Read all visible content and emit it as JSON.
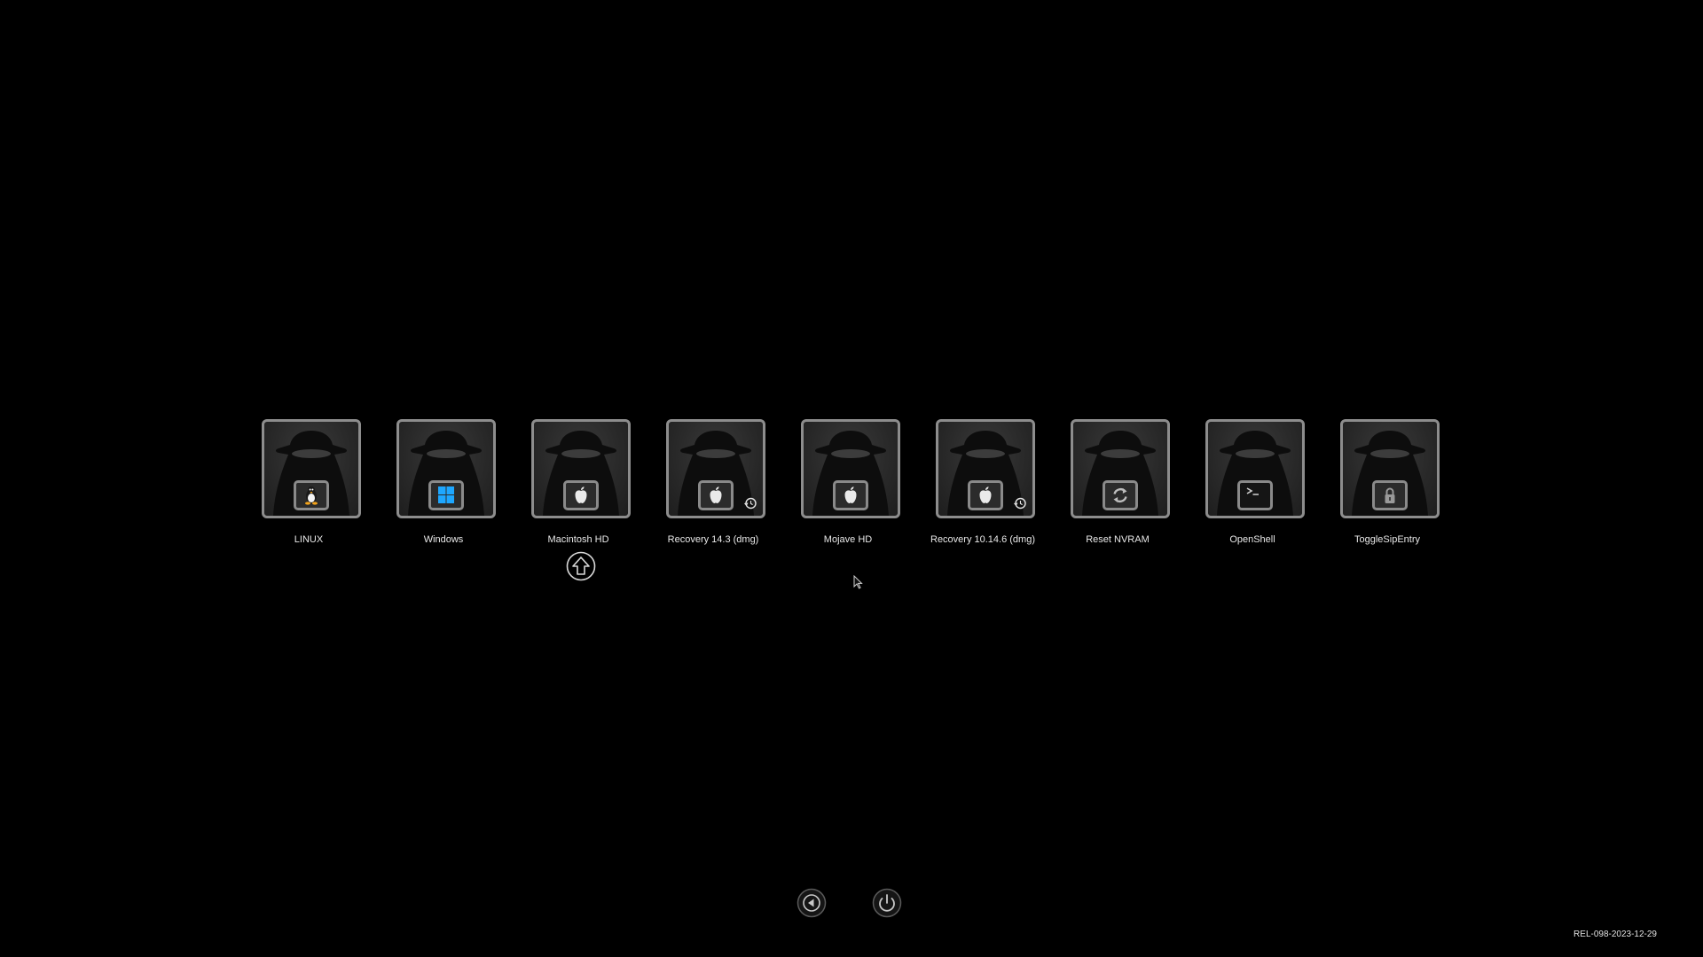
{
  "entries": [
    {
      "label": "LINUX",
      "badge_icon": "linux-penguin-icon",
      "recovery": false
    },
    {
      "label": "Windows",
      "badge_icon": "windows-logo-icon",
      "recovery": false
    },
    {
      "label": "Macintosh HD",
      "badge_icon": "apple-logo-icon",
      "recovery": false,
      "selected": true
    },
    {
      "label": "Recovery 14.3 (dmg)",
      "badge_icon": "apple-logo-icon",
      "recovery": true
    },
    {
      "label": "Mojave HD",
      "badge_icon": "apple-logo-icon",
      "recovery": false
    },
    {
      "label": "Recovery 10.14.6 (dmg)",
      "badge_icon": "apple-logo-icon",
      "recovery": true
    },
    {
      "label": "Reset NVRAM",
      "badge_icon": "reset-arrows-icon",
      "recovery": false
    },
    {
      "label": "OpenShell",
      "badge_icon": "terminal-prompt-icon",
      "recovery": false
    },
    {
      "label": "ToggleSipEntry",
      "badge_icon": "lock-icon",
      "recovery": false
    }
  ],
  "selector_icon": "up-arrow-selector-icon",
  "controls": {
    "restart_icon": "restart-left-arrow-icon",
    "shutdown_icon": "power-icon"
  },
  "version": "REL-098-2023-12-29",
  "colors": {
    "background": "#000000",
    "tile_border": "#8d8d8d",
    "label": "#e8e8e8",
    "windows_blue": "#1ea7ff",
    "penguin_orange": "#f2a31b"
  }
}
